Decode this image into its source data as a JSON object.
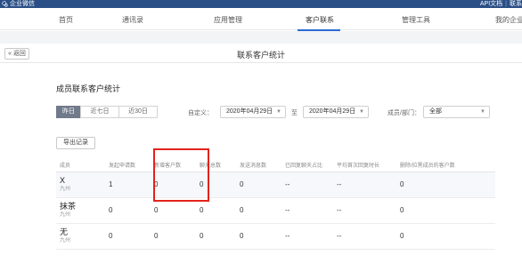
{
  "topbar": {
    "brand": "企业微信",
    "links": [
      "API文档",
      "联系"
    ]
  },
  "nav": {
    "items": [
      {
        "label": "首页",
        "active": false
      },
      {
        "label": "通讯录",
        "active": false
      },
      {
        "label": "应用管理",
        "active": false
      },
      {
        "label": "客户联系",
        "active": true
      },
      {
        "label": "管理工具",
        "active": false
      },
      {
        "label": "我的企业",
        "active": false
      }
    ]
  },
  "subheader": {
    "back": "« 返回",
    "title": "联系客户统计"
  },
  "stats": {
    "title": "成员联系客户统计",
    "range_tabs": [
      {
        "label": "昨日",
        "active": true
      },
      {
        "label": "近七日",
        "active": false
      },
      {
        "label": "近30日",
        "active": false
      }
    ],
    "custom_label": "自定义：",
    "start_date": "2020年04月29日",
    "to": "至",
    "end_date": "2020年04月29日",
    "member_label": "成员/部门：",
    "member_value": "全部",
    "export": "导出记录",
    "columns": [
      "成员",
      "发起申请数",
      "新增客户数",
      "聊天总数",
      "发送消息数",
      "已回复聊天占比",
      "平均首次回复时长",
      "删除/拉黑成员的客户数"
    ],
    "rows": [
      {
        "name": "X",
        "org": "九州",
        "cells": [
          "1",
          "0",
          "0",
          "0",
          "--",
          "--",
          "0"
        ]
      },
      {
        "name": "抹茶",
        "org": "九州",
        "cells": [
          "0",
          "0",
          "0",
          "0",
          "--",
          "--",
          "0"
        ]
      },
      {
        "name": "无",
        "org": "九州",
        "cells": [
          "0",
          "0",
          "0",
          "0",
          "--",
          "--",
          "0"
        ]
      }
    ]
  },
  "colors": {
    "topbar": "#2a4f86",
    "accent": "#2b6ad1",
    "highlight_box": "#e2231a"
  }
}
